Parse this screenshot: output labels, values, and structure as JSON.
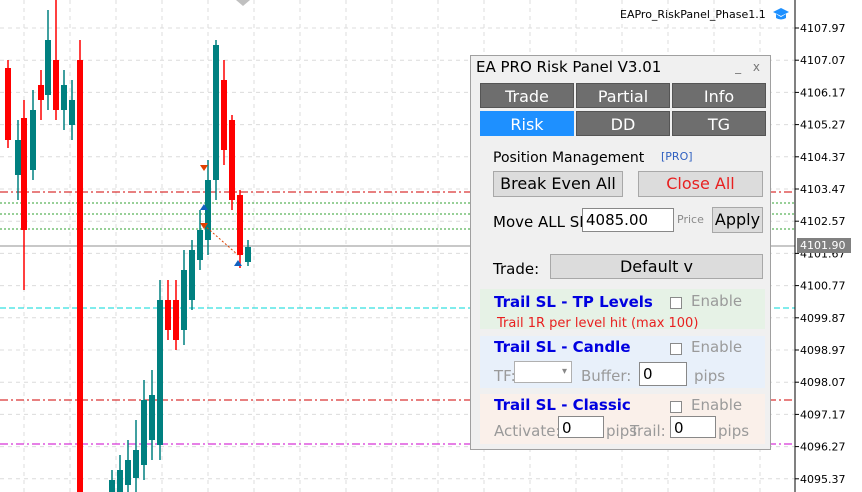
{
  "chart": {
    "symbol_title": "EAPro_RiskPanel_Phase1.1",
    "price_axis": [
      "4107.97",
      "4107.07",
      "4106.17",
      "4105.27",
      "4104.37",
      "4103.47",
      "4102.57",
      "4101.67",
      "4100.77",
      "4099.87",
      "4098.97",
      "4098.07",
      "4097.17",
      "4096.27",
      "4095.37"
    ],
    "current_price": "4101.90",
    "colors": {
      "bull": "#008080",
      "bear": "#ff0000",
      "grid": "#d8d8d8"
    }
  },
  "panel": {
    "title": "EA PRO Risk Panel V3.01",
    "minimize": "_",
    "close": "x",
    "tabs_row1": [
      "Trade",
      "Partial",
      "Info"
    ],
    "tabs_row2": [
      "Risk",
      "DD",
      "TG"
    ],
    "active_tab": "Risk",
    "position_management": "Position Management",
    "pro_badge": "[PRO]",
    "break_even_all": "Break Even All",
    "close_all": "Close All",
    "move_all_sl_label": "Move ALL SL:",
    "move_all_sl_value": "4085.00",
    "price_hint": "Price",
    "apply": "Apply",
    "trade_label": "Trade:",
    "trade_select": "Default v",
    "trail_tp": {
      "title": "Trail SL - TP Levels",
      "enable": "Enable",
      "note": "Trail 1R per level hit  (max 100)"
    },
    "trail_candle": {
      "title": "Trail SL - Candle",
      "enable": "Enable",
      "tf_label": "TF:",
      "buffer_label": "Buffer:",
      "buffer_value": "0",
      "pips": "pips"
    },
    "trail_classic": {
      "title": "Trail SL - Classic",
      "enable": "Enable",
      "activate_label": "Activate:",
      "activate_value": "0",
      "pips1": "pips",
      "trail_label": "Trail:",
      "trail_value": "0",
      "pips2": "pips"
    }
  }
}
